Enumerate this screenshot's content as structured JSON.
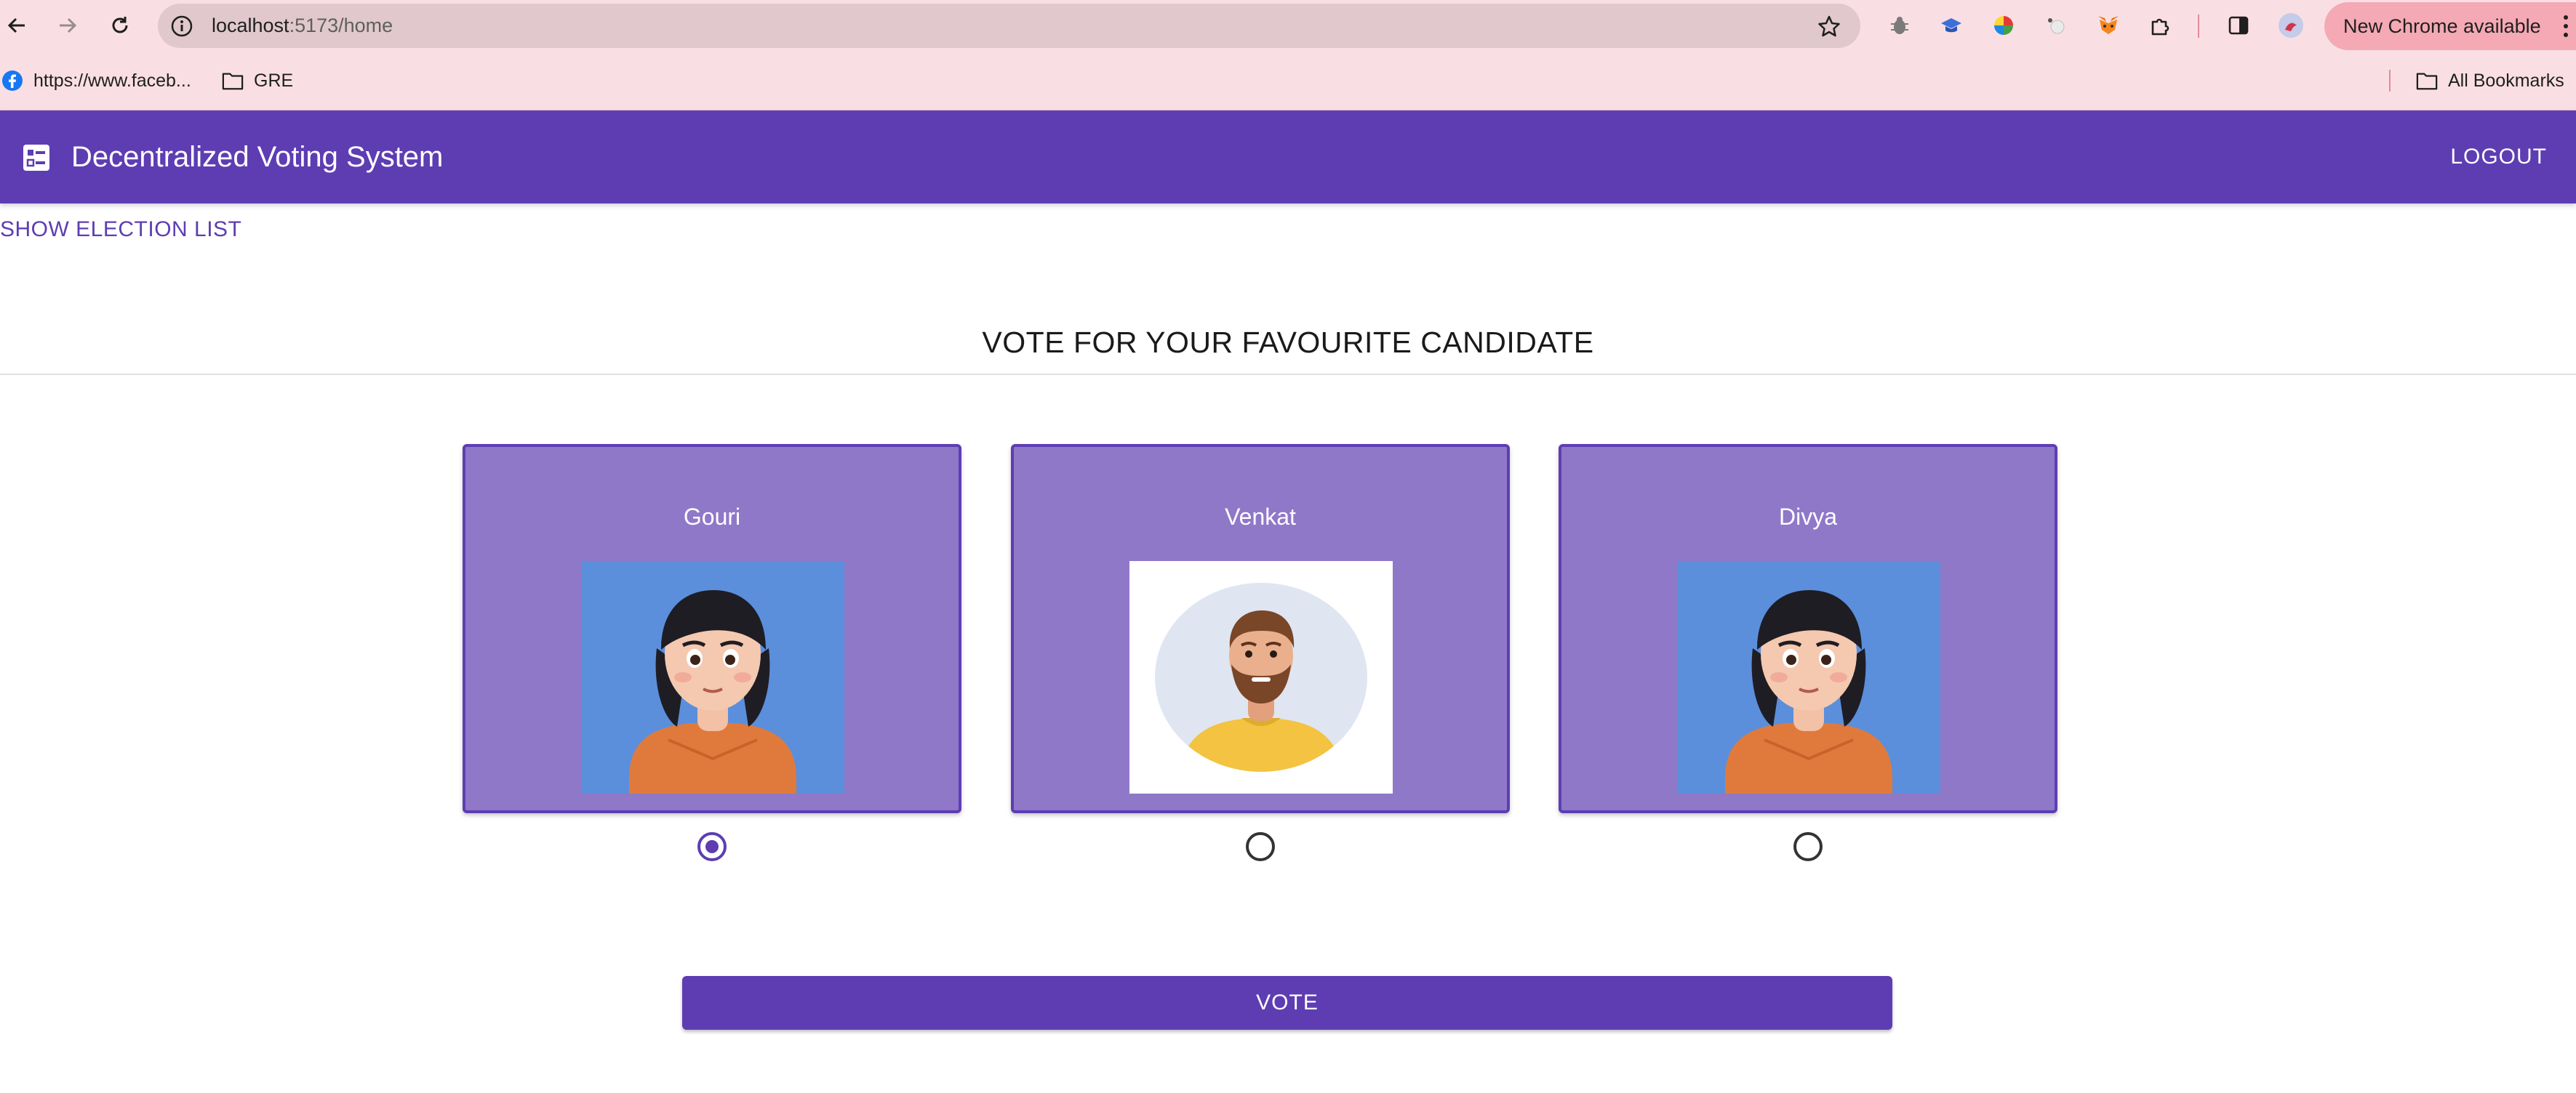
{
  "browser": {
    "url_host": "localhost",
    "url_path": ":5173/home",
    "update_label": "New Chrome available",
    "bookmarks": [
      {
        "label": "https://www.faceb..."
      },
      {
        "label": "GRE"
      }
    ],
    "all_bookmarks_label": "All Bookmarks"
  },
  "app": {
    "title": "Decentralized Voting System",
    "logout_label": "LOGOUT",
    "show_list_label": "SHOW ELECTION LIST",
    "heading": "VOTE FOR YOUR FAVOURITE CANDIDATE",
    "vote_label": "VOTE",
    "accent_color": "#5e3db3",
    "card_color": "#8f78c8"
  },
  "candidates": [
    {
      "name": "Gouri",
      "selected": true,
      "avatar": "girl-avatar",
      "photo_bg": "#5b8fdc"
    },
    {
      "name": "Venkat",
      "selected": false,
      "avatar": "bearded-man-avatar",
      "photo_bg": "#ffffff"
    },
    {
      "name": "Divya",
      "selected": false,
      "avatar": "girl-avatar",
      "photo_bg": "#5b8fdc"
    }
  ]
}
